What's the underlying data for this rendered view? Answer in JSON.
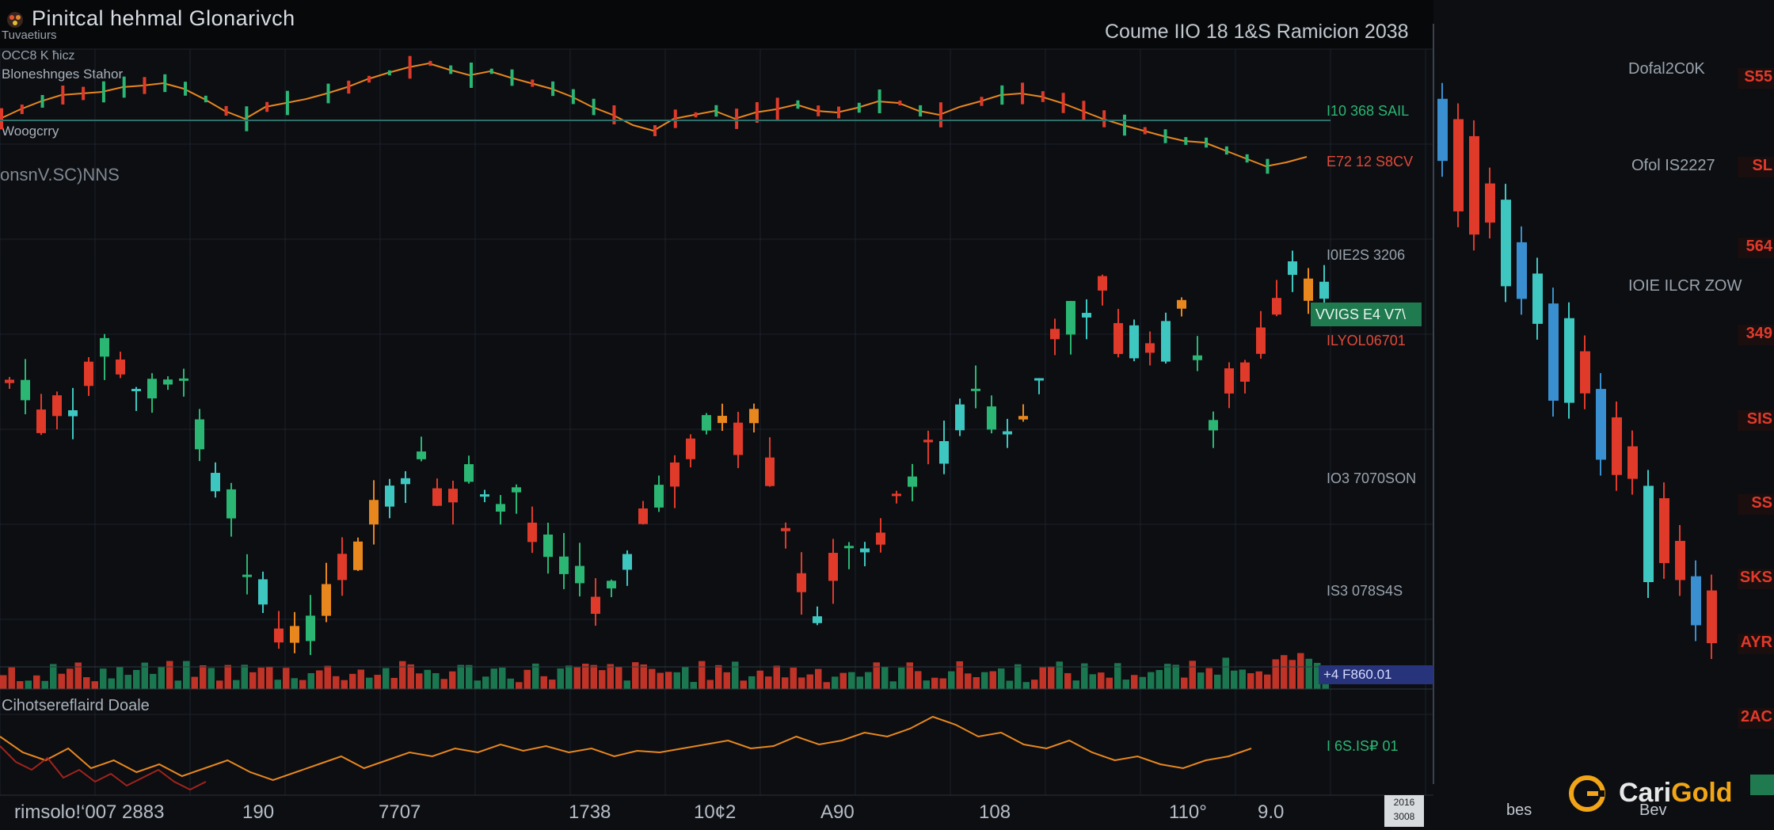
{
  "header": {
    "app_title": "Pinitcal hehmal Glonarivch",
    "sub1": "Tuvaetiurs",
    "sub2": "OCC8 K ħicz",
    "sub3": "Bloneshnges Stahor",
    "sub4": "Woogcrry",
    "sub5": "onsnV.SC)NNS",
    "chart_heading": "Coume IIO 18 1&S Ramicion 2038",
    "indicator_label": "Cihotsereflaird Doale"
  },
  "price_scale": [
    {
      "text": "I10 368 SAIL",
      "style": "green",
      "top": 0
    },
    {
      "text": "E72 12 S8CV",
      "style": "red"
    },
    {
      "text": "I0IE2S 3206",
      "style": "plain"
    },
    {
      "text": "VVIGS E4 V7\\",
      "style": "box-green"
    },
    {
      "text": "ILYOL06701",
      "style": "red"
    },
    {
      "text": "IO3 7070SON",
      "style": "plain"
    },
    {
      "text": "IS3 078S4S",
      "style": "plain"
    },
    {
      "text": "+4 F860.01",
      "style": "box-blue"
    },
    {
      "text": "I 6S.IS₽ 01",
      "style": "green"
    }
  ],
  "x_axis_labels": [
    "rimsolo!‘007 2883",
    "190",
    "7707",
    "1738",
    "10¢2",
    "A90",
    "108",
    "110°",
    "9.0"
  ],
  "date_box": [
    "2016",
    "3008"
  ],
  "right_panel": {
    "labels": [
      "Dofal2C0K",
      "Ofol IS2227",
      "IOIE ILCR ZOW",
      "bes",
      "Bev"
    ],
    "tags": [
      "S55",
      "SL",
      "564",
      "349",
      "SIS",
      "SS",
      "SKS",
      "AYR",
      "2AC"
    ]
  },
  "brand": {
    "name_white": "Cari",
    "name_gold": "Gold"
  },
  "colors": {
    "up": "#2bb673",
    "down": "#e03a2b",
    "teal": "#3ec7c0",
    "orange": "#e8871e",
    "grid": "#1d232b"
  },
  "chart_data": {
    "type": "candlestick",
    "title": "Coume IIO 18 1&S Ramicion 2038",
    "x_tick_labels": [
      "rimsolo!‘007 2883",
      "190",
      "7707",
      "1738",
      "10¢2",
      "A90",
      "108",
      "110°",
      "9.0"
    ],
    "price_axis_labels": [
      "I10 368 SAIL",
      "E72 12 S8CV",
      "I0IE2S 3206",
      "VVIGS E4 V7\\",
      "ILYOL06701",
      "IO3 7070SON",
      "IS3 078S4S",
      "+4 F860.01"
    ],
    "grid": true,
    "series": [
      {
        "kind": "candles",
        "path_closes": [
          480,
          505,
          530,
          515,
          545,
          460,
          440,
          470,
          500,
          480,
          470,
          505,
          540,
          600,
          640,
          700,
          760,
          800,
          820,
          780,
          760,
          720,
          700,
          660,
          640,
          620,
          600,
          640,
          620,
          600,
          650,
          640,
          620,
          660,
          680,
          700,
          740,
          760,
          720,
          690,
          660,
          640,
          600,
          560,
          520,
          540,
          560,
          540,
          600,
          680,
          740,
          760,
          720,
          700,
          680,
          660,
          620,
          600,
          580,
          560,
          520,
          500,
          540,
          560,
          520,
          480,
          440,
          400,
          380,
          360,
          420,
          440,
          460,
          430,
          400,
          460,
          520,
          480,
          460,
          430,
          400,
          360,
          380,
          360
        ]
      },
      {
        "kind": "upper_line",
        "path": [
          150,
          138,
          128,
          120,
          118,
          116,
          110,
          108,
          105,
          112,
          125,
          140,
          150,
          135,
          130,
          125,
          118,
          110,
          100,
          92,
          85,
          80,
          88,
          95,
          90,
          98,
          105,
          112,
          122,
          135,
          145,
          158,
          165,
          150,
          145,
          140,
          150,
          142,
          138,
          132,
          140,
          142,
          136,
          128,
          130,
          140,
          145,
          135,
          128,
          120,
          118,
          122,
          130,
          140,
          150,
          158,
          165,
          172,
          178,
          180,
          190,
          200,
          210,
          205,
          198
        ]
      },
      {
        "kind": "volume",
        "count": 160
      },
      {
        "kind": "oscillator",
        "path": [
          930,
          950,
          960,
          945,
          970,
          960,
          975,
          965,
          980,
          970,
          960,
          975,
          985,
          975,
          965,
          955,
          970,
          960,
          950,
          955,
          945,
          950,
          940,
          948,
          942,
          950,
          945,
          955,
          948,
          950,
          945,
          940,
          935,
          945,
          942,
          930,
          940,
          935,
          925,
          930,
          920,
          905,
          915,
          930,
          925,
          940,
          945,
          935,
          950,
          960,
          955,
          965,
          970,
          960,
          955,
          945
        ]
      },
      {
        "kind": "right_candles",
        "count": 18
      }
    ]
  }
}
